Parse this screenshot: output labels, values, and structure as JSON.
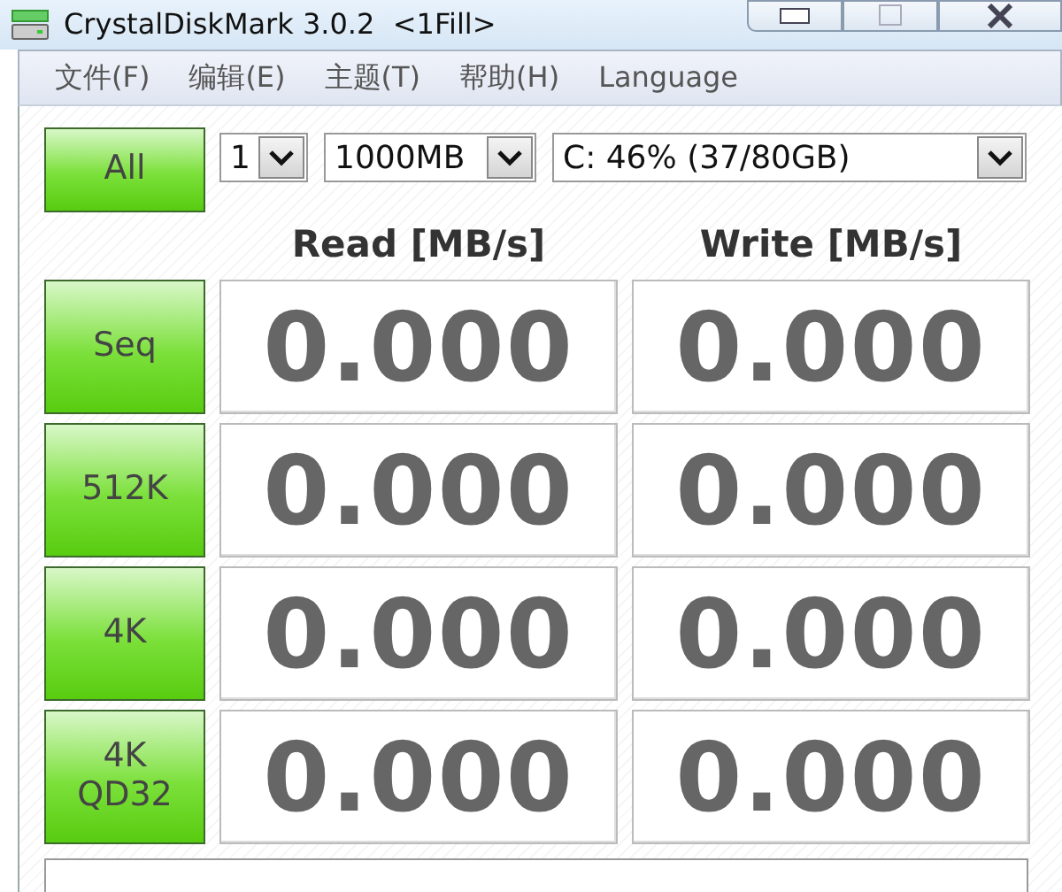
{
  "window": {
    "title": "CrystalDiskMark 3.0.2  <1Fill>"
  },
  "menu": [
    "文件(F)",
    "编辑(E)",
    "主题(T)",
    "帮助(H)",
    "Language"
  ],
  "all_button": "All",
  "selectors": [
    {
      "kind": "count",
      "value": "1"
    },
    {
      "kind": "size",
      "value": "1000MB"
    },
    {
      "kind": "drive",
      "value": "C: 46% (37/80GB)"
    }
  ],
  "columns": [
    "Read [MB/s]",
    "Write [MB/s]"
  ],
  "rows": [
    {
      "test": "Seq",
      "read": "0.000",
      "write": "0.000"
    },
    {
      "test": "512K",
      "read": "0.000",
      "write": "0.000"
    },
    {
      "test": "4K",
      "read": "0.000",
      "write": "0.000"
    },
    {
      "test": "4K\nQD32",
      "read": "0.000",
      "write": "0.000"
    }
  ]
}
